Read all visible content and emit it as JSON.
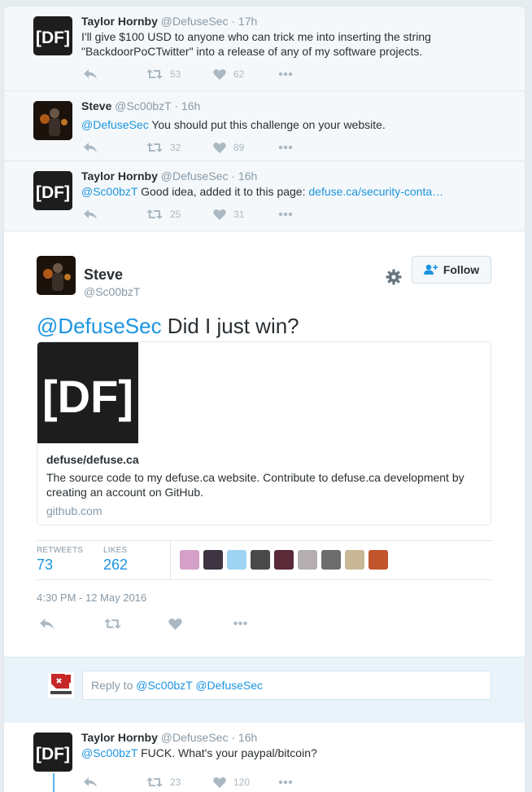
{
  "tweets": [
    {
      "name": "Taylor Hornby",
      "handle": "@DefuseSec",
      "time": "· 17h",
      "text": "I'll give $100 USD to anyone who can trick me into inserting the string \"BackdoorPoCTwitter\" into a release of any of my software projects.",
      "retweets": "53",
      "likes": "62"
    },
    {
      "name": "Steve",
      "handle": "@Sc00bzT",
      "time": "· 16h",
      "mention": "@DefuseSec",
      "text": " You should put this challenge on your website.",
      "retweets": "32",
      "likes": "89"
    },
    {
      "name": "Taylor Hornby",
      "handle": "@DefuseSec",
      "time": "· 16h",
      "mention": "@Sc00bzT",
      "text": " Good idea, added it to this page: ",
      "link": "defuse.ca/security-conta…",
      "retweets": "25",
      "likes": "31"
    }
  ],
  "focus": {
    "name": "Steve",
    "handle": "@Sc00bzT",
    "follow_label": "Follow",
    "mention": "@DefuseSec",
    "text": " Did I just win?",
    "card": {
      "logo_text": "[DF]",
      "title": "defuse/defuse.ca",
      "description": "The source code to my defuse.ca website. Contribute to defuse.ca development by creating an account on GitHub.",
      "domain": "github.com"
    },
    "stats": {
      "retweets_label": "RETWEETS",
      "retweets": "73",
      "likes_label": "LIKES",
      "likes": "262"
    },
    "timestamp": "4:30 PM - 12 May 2016"
  },
  "reply": {
    "prefix": "Reply to ",
    "mentions": "@Sc00bzT @DefuseSec"
  },
  "last_tweet": {
    "name": "Taylor Hornby",
    "handle": "@DefuseSec",
    "time": "· 16h",
    "mention": "@Sc00bzT",
    "text": " FUCK. What's your paypal/bitcoin?",
    "retweets": "23",
    "likes": "120"
  },
  "colors": {
    "link": "#1b95e0",
    "action_grey": "#aab8c2",
    "conversation_bg": "#f5f8fa"
  }
}
